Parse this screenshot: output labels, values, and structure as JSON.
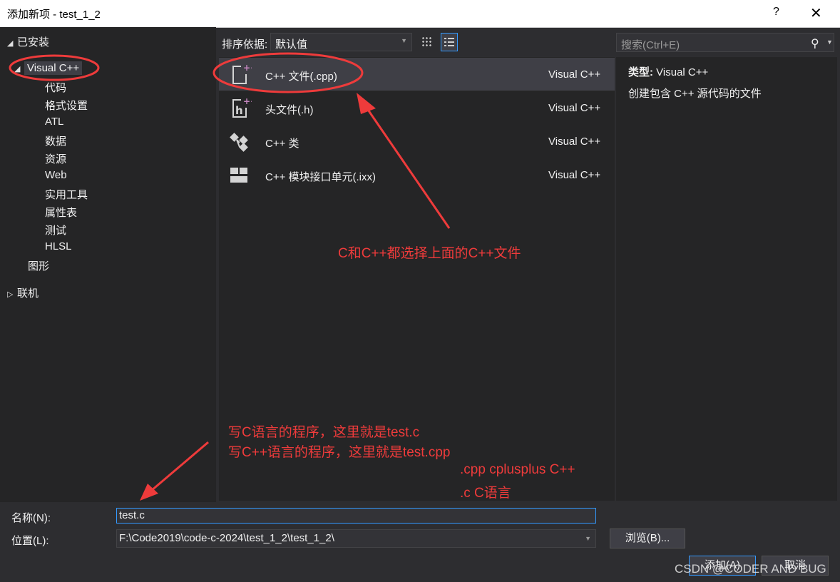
{
  "window": {
    "title": "添加新项 - test_1_2",
    "help": "?",
    "close": "✕"
  },
  "tree": {
    "installed": "已安装",
    "visual_cpp": "Visual C++",
    "children": [
      "代码",
      "格式设置",
      "ATL",
      "数据",
      "资源",
      "Web",
      "实用工具",
      "属性表",
      "测试",
      "HLSL"
    ],
    "graphics": "图形",
    "online": "联机"
  },
  "sort": {
    "label": "排序依据:",
    "value": "默认值"
  },
  "search": {
    "placeholder": "搜索(Ctrl+E)"
  },
  "templates": [
    {
      "name": "C++ 文件(.cpp)",
      "lang": "Visual C++",
      "icon": "cpp-file-icon"
    },
    {
      "name": "头文件(.h)",
      "lang": "Visual C++",
      "icon": "header-file-icon"
    },
    {
      "name": "C++ 类",
      "lang": "Visual C++",
      "icon": "cpp-class-icon"
    },
    {
      "name": "C++ 模块接口单元(.ixx)",
      "lang": "Visual C++",
      "icon": "module-interface-icon"
    }
  ],
  "info": {
    "type_label": "类型:",
    "type_value": "Visual C++",
    "description": "创建包含 C++ 源代码的文件"
  },
  "form": {
    "name_label": "名称(N):",
    "name_value": "test.c",
    "location_label": "位置(L):",
    "location_value": "F:\\Code2019\\code-c-2024\\test_1_2\\test_1_2\\",
    "browse": "浏览(B)...",
    "add": "添加(A)",
    "cancel": "取消"
  },
  "annotations": {
    "choose_cpp": "C和C++都选择上面的C++文件",
    "line1": "写C语言的程序，这里就是test.c",
    "line2": "写C++语言的程序，这里就是test.cpp",
    "line3": ".cpp cplusplus C++",
    "line4": ".c C语言"
  },
  "watermark": "CSDN @CODER AND BUG",
  "colors": {
    "annotation": "#ee3b3b",
    "accent": "#3399ff",
    "background": "#2d2d30"
  }
}
